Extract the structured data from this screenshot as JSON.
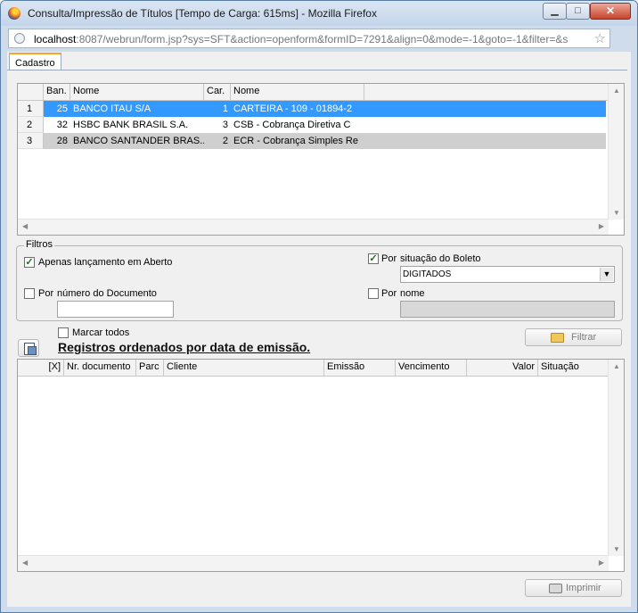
{
  "window": {
    "title": "Consulta/Impressão de Títulos [Tempo de Carga: 615ms] - Mozilla Firefox",
    "min_label": "▁",
    "max_label": "□",
    "close_label": "✕"
  },
  "url": {
    "host": "localhost",
    "rest": ":8087/webrun/form.jsp?sys=SFT&action=openform&formID=7291&align=0&mode=-1&goto=-1&filter=&s"
  },
  "tab": {
    "label": "Cadastro"
  },
  "bank_grid": {
    "headers": [
      "Ban.",
      "Nome",
      "Car.",
      "Nome"
    ],
    "rows": [
      {
        "n": "1",
        "ban": "25",
        "nome": "BANCO ITAU S/A",
        "car": "1",
        "cart_nome": "CARTEIRA - 109 - 01894-2"
      },
      {
        "n": "2",
        "ban": "32",
        "nome": "HSBC BANK BRASIL S.A.",
        "car": "3",
        "cart_nome": "CSB - Cobrança Diretiva C"
      },
      {
        "n": "3",
        "ban": "28",
        "nome": "BANCO SANTANDER BRAS...",
        "car": "2",
        "cart_nome": "ECR - Cobrança Simples Re"
      }
    ]
  },
  "filters": {
    "legend": "Filtros",
    "aberto": {
      "label": "Apenas lançamento em Aberto",
      "checked": true
    },
    "situacao": {
      "por": "Por",
      "label": "situação do Boleto",
      "checked": true,
      "value": "DIGITADOS"
    },
    "documento": {
      "por": "Por",
      "label": "número do Documento",
      "checked": false,
      "value": ""
    },
    "nome": {
      "por": "Por",
      "label": "nome",
      "checked": false,
      "value": ""
    }
  },
  "marcar_todos": {
    "label": "Marcar todos",
    "checked": false
  },
  "filtrar_button": "Filtrar",
  "ordered_heading": "Registros ordenados por data de emissão.",
  "titles_grid": {
    "headers": [
      "[X]",
      "Nr. documento",
      "Parc",
      "Cliente",
      "Emissão",
      "Vencimento",
      "Valor",
      "Situação"
    ]
  },
  "imprimir_button": "Imprimir",
  "icons": {
    "browser": "firefox-icon",
    "site": "globe-icon",
    "bookmark": "star-icon",
    "filter": "folder-icon",
    "print": "printer-icon",
    "sort": "sort-icon"
  },
  "colors": {
    "selection": "#3399ff",
    "tab_accent": "#f5a623"
  }
}
